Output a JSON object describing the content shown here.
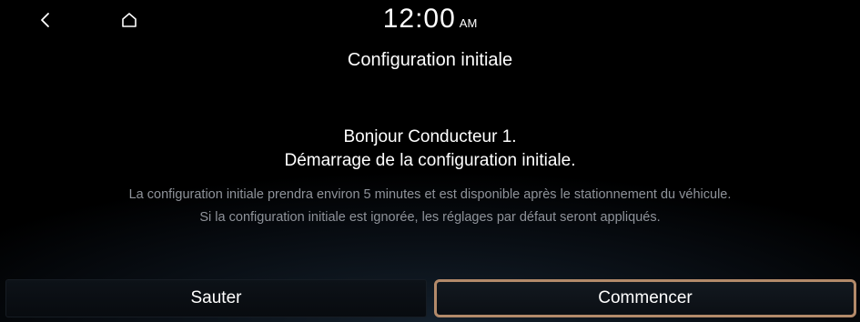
{
  "status_bar": {
    "time": "12:00",
    "ampm": "AM"
  },
  "icons": {
    "back": "back-arrow-icon",
    "home": "home-icon"
  },
  "page": {
    "title": "Configuration initiale",
    "greeting_line1": "Bonjour Conducteur 1.",
    "greeting_line2": "Démarrage de la configuration initiale.",
    "description_line1": "La configuration initiale prendra environ 5 minutes et est disponible après le stationnement du véhicule.",
    "description_line2": "Si la configuration initiale est ignorée, les réglages par défaut seront appliqués."
  },
  "buttons": {
    "skip_label": "Sauter",
    "start_label": "Commencer"
  },
  "colors": {
    "background": "#000000",
    "secondary_text": "#8f939a",
    "focus_border": "#b38a6a"
  }
}
